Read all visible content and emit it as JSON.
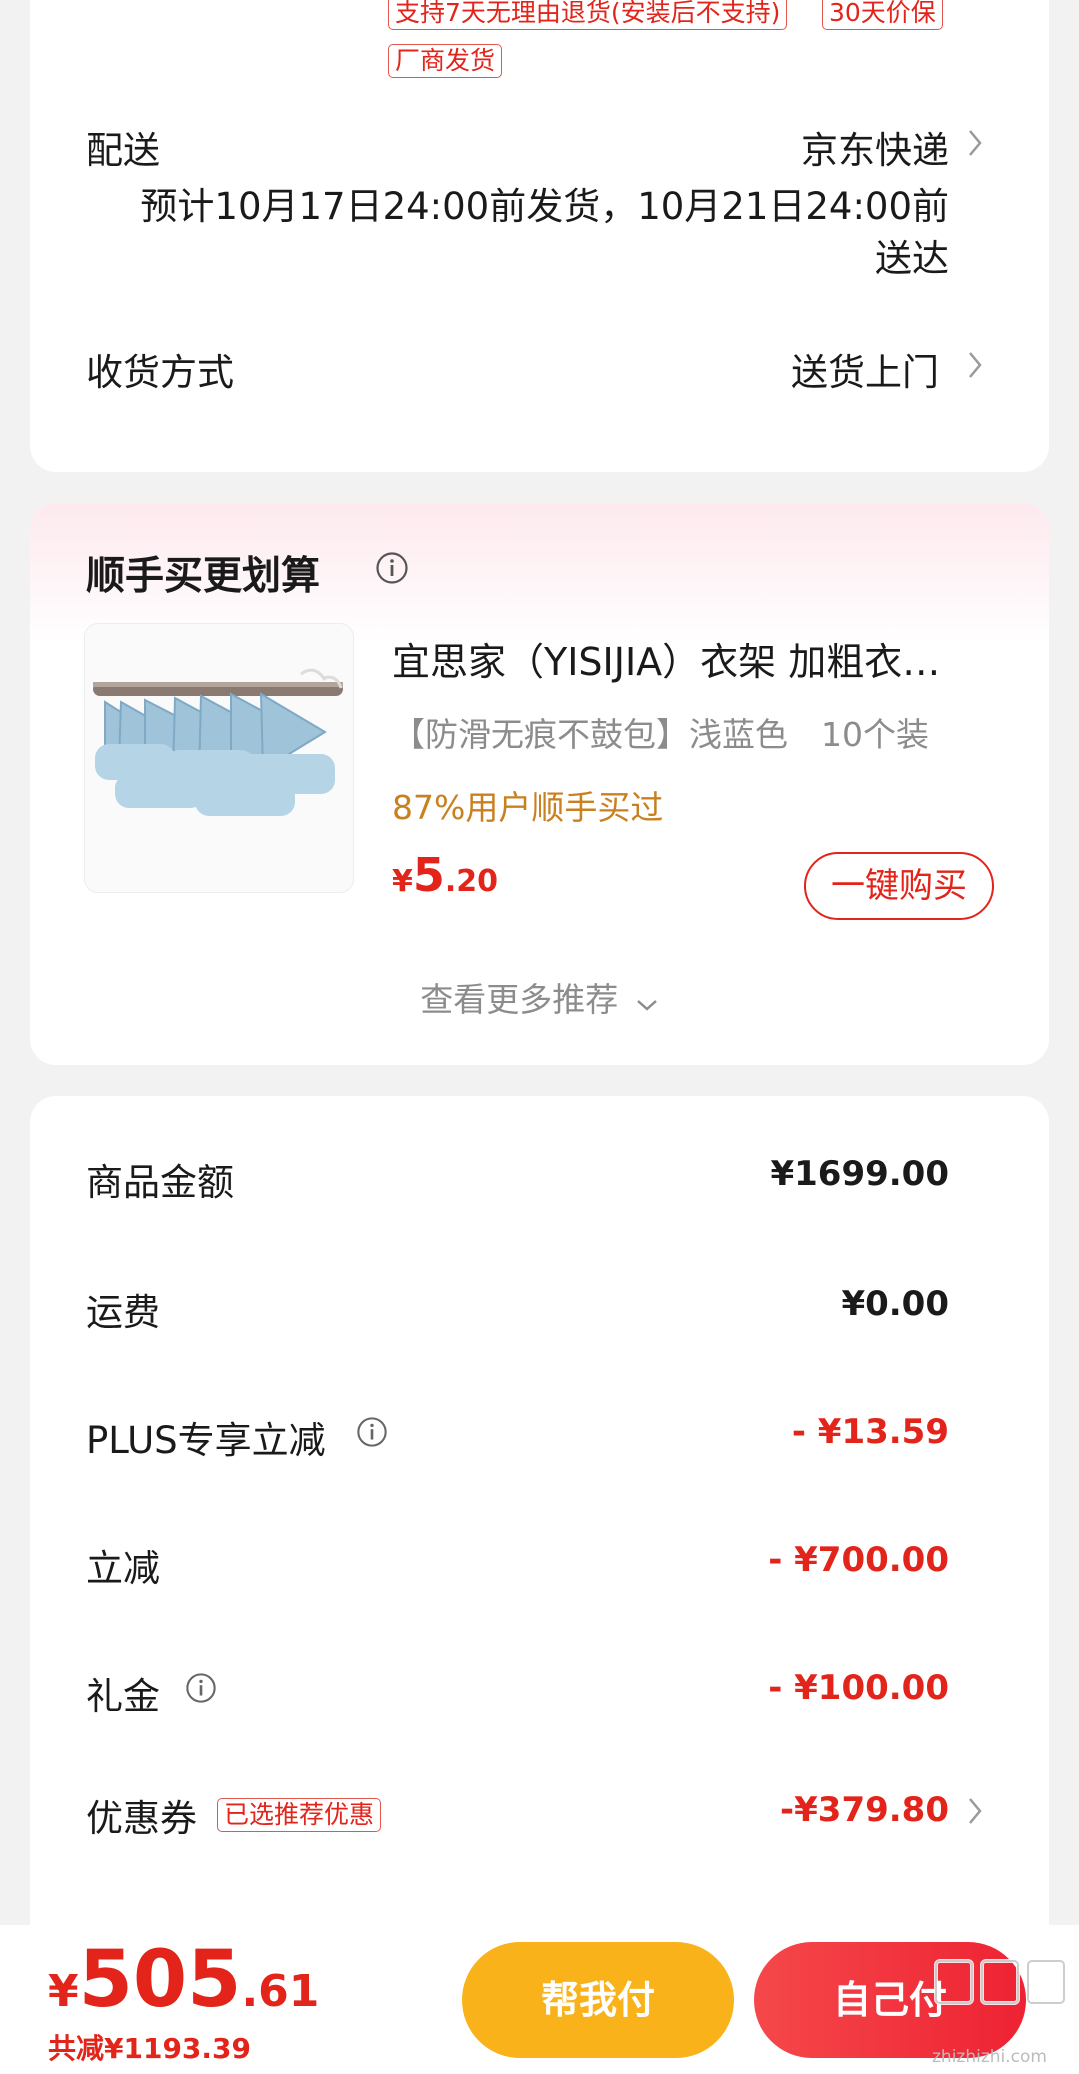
{
  "top_tags": [
    "支持7天无理由退货(安装后不支持)",
    "30天价保",
    "厂商发货"
  ],
  "delivery": {
    "label": "配送",
    "carrier": "京东快递",
    "estimate_line1": "预计10月17日24:00前发货，10月21日24:00前",
    "estimate_line2": "送达"
  },
  "receive": {
    "label": "收货方式",
    "value": "送货上门"
  },
  "recommend": {
    "title": "顺手买更划算",
    "product_title": "宜思家（YISIJIA）衣架 加粗衣…",
    "product_spec": "【防滑无痕不鼓包】浅蓝色　10个装",
    "product_stat": "87%用户顺手买过",
    "price_symbol": "¥",
    "price_int": "5",
    "price_dec": ".20",
    "buy_label": "一键购买",
    "more_label": "查看更多推荐"
  },
  "summary": [
    {
      "label": "商品金额",
      "value": "¥1699.00",
      "red": false,
      "info": false,
      "chev": false
    },
    {
      "label": "运费",
      "value": "¥0.00",
      "red": false,
      "info": false,
      "chev": false
    },
    {
      "label": "PLUS专享立减",
      "value": "- ¥13.59",
      "red": true,
      "info": true,
      "chev": false
    },
    {
      "label": "立减",
      "value": "- ¥700.00",
      "red": true,
      "info": false,
      "chev": false
    },
    {
      "label": "礼金",
      "value": "- ¥100.00",
      "red": true,
      "info": true,
      "chev": false
    },
    {
      "label": "优惠券",
      "value": "-¥379.80",
      "red": true,
      "info": false,
      "chev": true,
      "tag": "已选推荐优惠"
    }
  ],
  "bottom": {
    "currency": "¥",
    "total_int": "505",
    "total_dec": ".61",
    "saved": "共减¥1193.39",
    "help_pay": "帮我付",
    "self_pay": "自己付"
  },
  "watermark": {
    "site": "zhizhizhi.com"
  },
  "colors": {
    "accent_red": "#e2241a",
    "help_btn": "#f9b21a",
    "self_btn": "#f2303a",
    "stat_orange": "#c9801f"
  }
}
